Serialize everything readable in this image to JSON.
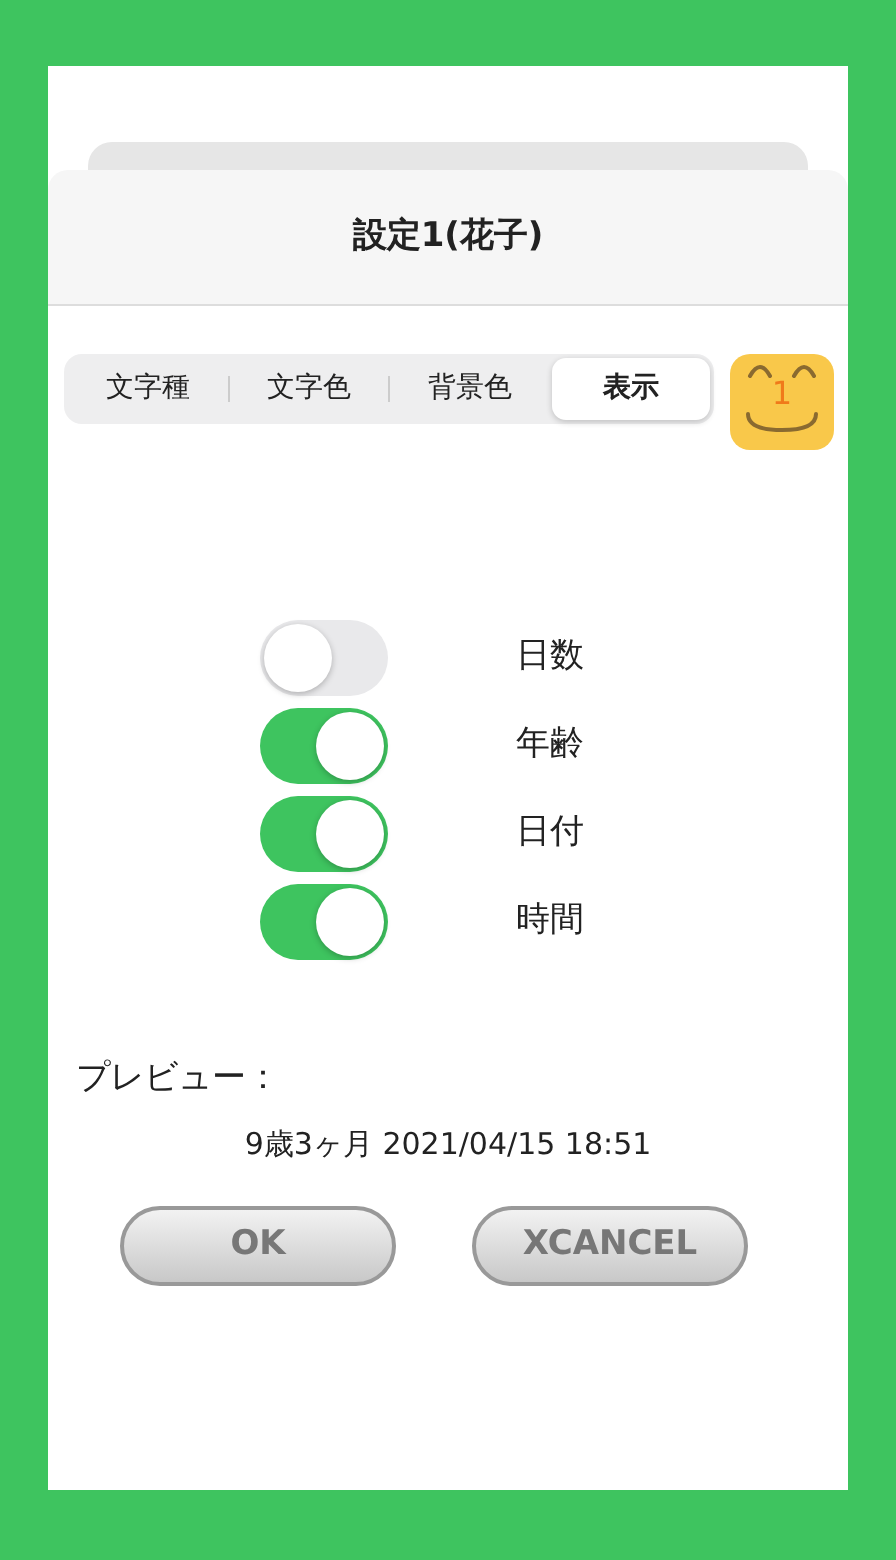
{
  "dialog": {
    "title": "設定1(花子)"
  },
  "tabs": [
    {
      "label": "文字種",
      "selected": false
    },
    {
      "label": "文字色",
      "selected": false
    },
    {
      "label": "背景色",
      "selected": false
    },
    {
      "label": "表示",
      "selected": true
    }
  ],
  "face_button": {
    "label": "1"
  },
  "toggles": [
    {
      "label": "日数",
      "on": false
    },
    {
      "label": "年齢",
      "on": true
    },
    {
      "label": "日付",
      "on": true
    },
    {
      "label": "時間",
      "on": true
    }
  ],
  "preview": {
    "label": "プレビュー：",
    "text": "9歳3ヶ月 2021/04/15 18:51"
  },
  "buttons": [
    {
      "label": "OK"
    },
    {
      "label": "XCANCEL"
    }
  ]
}
